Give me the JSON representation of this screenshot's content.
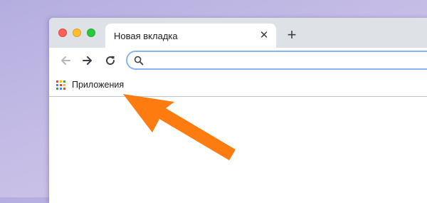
{
  "tab": {
    "title": "Новая вкладка",
    "close_glyph": "✕"
  },
  "new_tab": {
    "glyph": "+"
  },
  "omnibox": {
    "value": "",
    "placeholder": ""
  },
  "bookmarks": {
    "apps_label": "Приложения"
  },
  "colors": {
    "traffic_red": "#fe5f57",
    "traffic_yellow": "#febc2e",
    "traffic_green": "#28c840",
    "annotation_arrow": "#fe7c0f",
    "omnibox_focus": "#8ab4f8",
    "apps_grid": [
      "#ea4335",
      "#fbbc04",
      "#34a853",
      "#4285f4",
      "#ea4335",
      "#fbbc04",
      "#34a853",
      "#4285f4",
      "#ea4335"
    ]
  },
  "icons": {
    "back": "back-arrow-icon",
    "forward": "forward-arrow-icon",
    "reload": "reload-icon",
    "search": "search-icon",
    "apps": "apps-grid-icon",
    "annotation": "annotation-arrow-icon"
  }
}
